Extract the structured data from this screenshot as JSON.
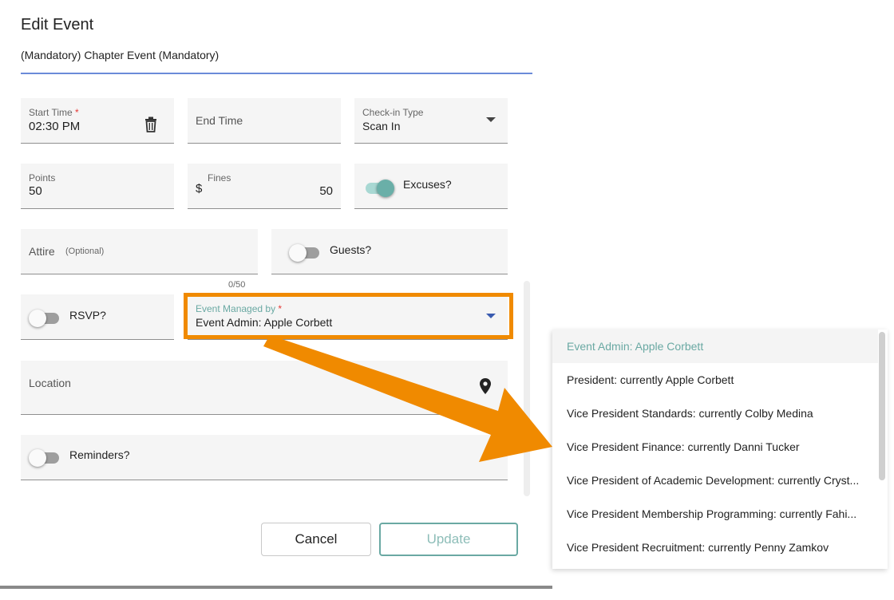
{
  "dialog": {
    "title": "Edit Event",
    "event_name": "(Mandatory) Chapter Event (Mandatory)"
  },
  "form": {
    "start_time": {
      "label": "Start Time",
      "required_mark": "*",
      "value": "02:30 PM",
      "icon": "trash-icon"
    },
    "end_time": {
      "placeholder": "End Time"
    },
    "checkin_type": {
      "label": "Check-in Type",
      "value": "Scan In"
    },
    "points": {
      "label": "Points",
      "value": "50"
    },
    "fines": {
      "label": "Fines",
      "prefix": "$",
      "value": "50"
    },
    "excuses": {
      "label": "Excuses?",
      "on": true
    },
    "attire": {
      "label": "Attire",
      "optional": "(Optional)",
      "counter": "0/50"
    },
    "guests": {
      "label": "Guests?",
      "on": false
    },
    "rsvp": {
      "label": "RSVP?",
      "on": false
    },
    "managed_by": {
      "label": "Event Managed by",
      "required_mark": "*",
      "value": "Event Admin: Apple Corbett"
    },
    "location": {
      "placeholder": "Location",
      "icon": "map-pin-icon"
    },
    "reminders": {
      "label": "Reminders?",
      "on": false
    }
  },
  "buttons": {
    "cancel": "Cancel",
    "update": "Update"
  },
  "dropdown": {
    "options": [
      "Event Admin: Apple Corbett",
      "President: currently Apple Corbett",
      "Vice President Standards: currently Colby Medina",
      "Vice President Finance: currently Danni Tucker",
      "Vice President of Academic Development: currently Cryst...",
      "Vice President Membership Programming: currently Fahi...",
      "Vice President Recruitment: currently Penny Zamkov"
    ],
    "selected_index": 0
  },
  "colors": {
    "accent": "#6aa9a3",
    "highlight": "#f08a00",
    "underline": "#6b8bd9",
    "required": "#e53935"
  }
}
